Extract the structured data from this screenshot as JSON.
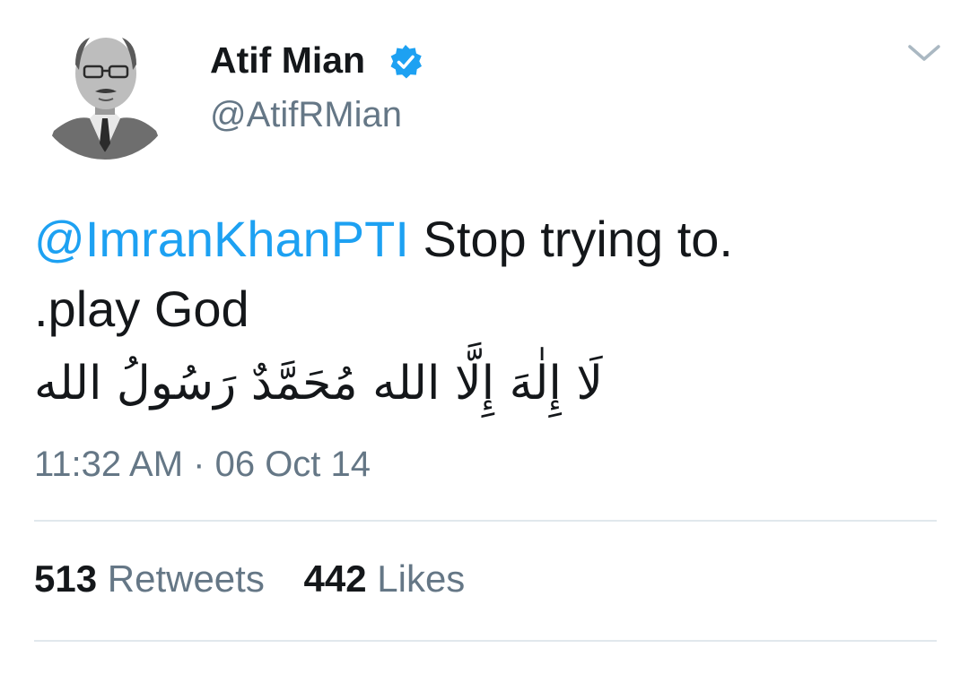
{
  "author": {
    "display_name": "Atif Mian",
    "handle": "@AtifRMian",
    "verified": true,
    "avatar": "sketch-portrait-avatar"
  },
  "tweet": {
    "mention": "@ImranKhanPTI",
    "text_line1": " Stop trying to.",
    "text_line2": ".play God",
    "arabic_text": "لَا إِلٰهَ إِلَّا الله مُحَمَّدٌ رَسُولُ الله",
    "timestamp": "11:32 AM · 06 Oct 14"
  },
  "stats": {
    "retweets_count": "513",
    "retweets_label": "Retweets",
    "likes_count": "442",
    "likes_label": "Likes"
  },
  "icons": {
    "verified_badge": "verified-badge-icon",
    "menu": "chevron-down-icon"
  },
  "colors": {
    "accent": "#1da1f2",
    "text": "#14171a",
    "secondary": "#657786",
    "divider": "#e1e8ed"
  }
}
